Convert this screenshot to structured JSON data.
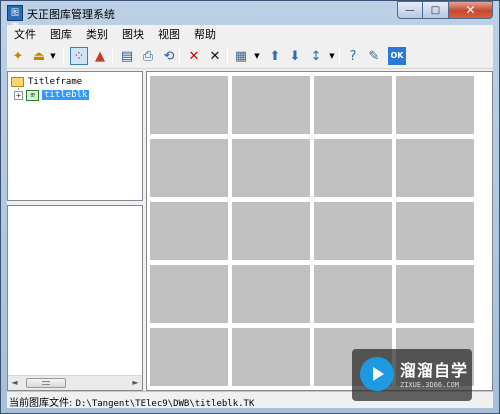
{
  "window": {
    "title": "天正图库管理系统",
    "app_icon_text": "图库",
    "controls": {
      "minimize": "—",
      "maximize": "□",
      "close": "✕"
    }
  },
  "menu": [
    "文件",
    "图库",
    "类别",
    "图块",
    "视图",
    "帮助"
  ],
  "toolbar": [
    {
      "name": "new-library-icon",
      "glyph": "✦",
      "color": "#c08a00"
    },
    {
      "name": "open-library-icon",
      "glyph": "⏏",
      "color": "#c08a00"
    },
    {
      "name": "dropdown-arrow",
      "glyph": "▼"
    },
    {
      "name": "grid-select-icon",
      "glyph": "⁘",
      "color": "#c0392b",
      "active": true
    },
    {
      "name": "triangle-icon",
      "glyph": "▲",
      "color": "#c0392b"
    },
    {
      "name": "book-icon",
      "glyph": "▤",
      "color": "#2a5a9c"
    },
    {
      "name": "export-icon",
      "glyph": "⎙",
      "color": "#2a5a9c"
    },
    {
      "name": "refresh-icon",
      "glyph": "⟲",
      "color": "#2a5a9c"
    },
    {
      "name": "delete-red-icon",
      "glyph": "✕",
      "color": "#d10000"
    },
    {
      "name": "delete-black-icon",
      "glyph": "✕",
      "color": "#111111"
    },
    {
      "name": "view-grid-icon",
      "glyph": "▦",
      "color": "#446688"
    },
    {
      "name": "dropdown-arrow",
      "glyph": "▼"
    },
    {
      "name": "move-up-icon",
      "glyph": "⬆",
      "color": "#2a6fb5"
    },
    {
      "name": "move-down-icon",
      "glyph": "⬇",
      "color": "#2a6fb5"
    },
    {
      "name": "sort-icon",
      "glyph": "↕",
      "color": "#2a6fb5"
    },
    {
      "name": "dropdown-arrow",
      "glyph": "▼"
    },
    {
      "name": "help-icon",
      "glyph": "?",
      "color": "#2a6fb5"
    },
    {
      "name": "insert-icon",
      "glyph": "✎",
      "color": "#446688"
    },
    {
      "name": "ok-icon",
      "glyph": "OK",
      "color": "#ffffff",
      "bg": "#2a7ad5"
    }
  ],
  "tree": {
    "root_label": "Titleframe",
    "child_label": "titleblk",
    "child_expander": "+"
  },
  "list_scrollbar": {
    "left": "◄",
    "right": "►"
  },
  "grid": {
    "rows": 5,
    "cols": 4,
    "cell_color": "#c0c0c0"
  },
  "status": {
    "label": "当前图库文件:",
    "path": "D:\\Tangent\\TElec9\\DWB\\titleblk.TK"
  },
  "watermark": {
    "title": "溜溜自学",
    "subtitle": "ZIXUE.3D66.COM"
  }
}
